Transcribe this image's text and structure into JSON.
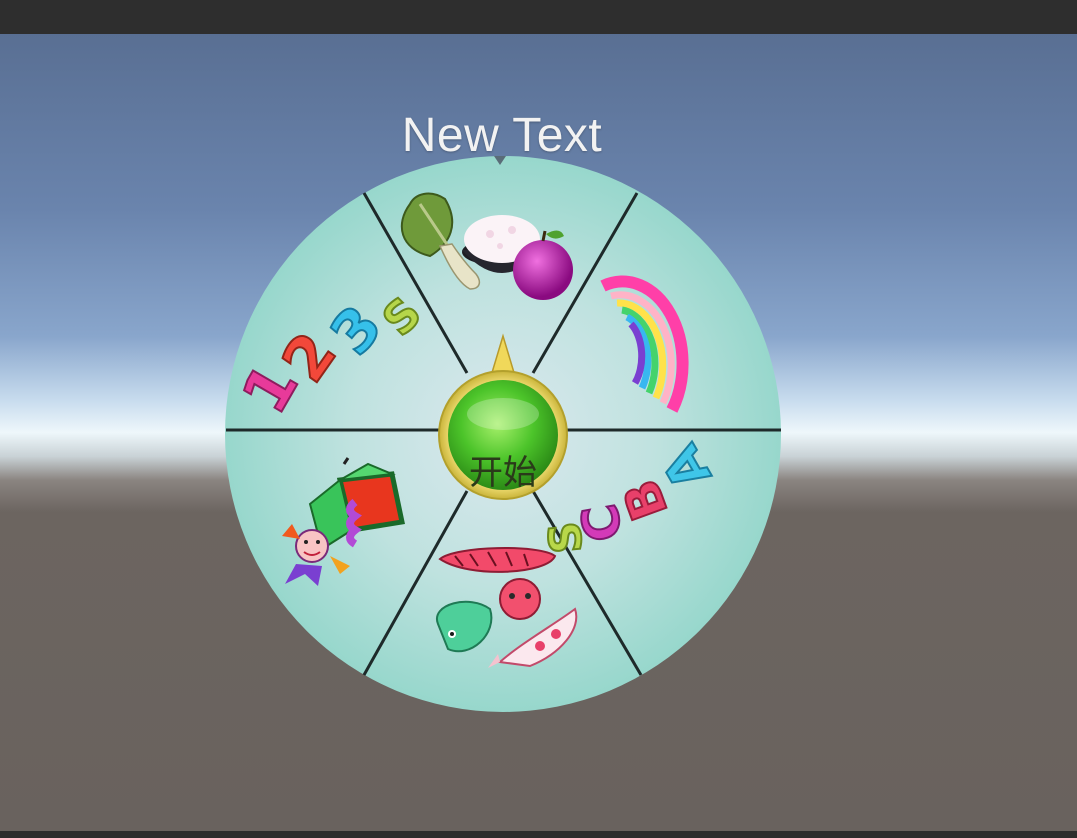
{
  "title": "New Text",
  "start_button_label": "开始",
  "segments": [
    {
      "name": "food",
      "icon": "food-icon"
    },
    {
      "name": "rainbow",
      "icon": "rainbow-icon"
    },
    {
      "name": "letters",
      "icon": "abcs-icon",
      "glyphs": [
        "A",
        "B",
        "C",
        "S"
      ]
    },
    {
      "name": "animals",
      "icon": "animals-icon"
    },
    {
      "name": "toy",
      "icon": "jack-in-box-icon"
    },
    {
      "name": "numbers",
      "icon": "numbers-icon",
      "glyphs": [
        "1",
        "2",
        "3",
        "S"
      ]
    }
  ],
  "colors": {
    "wheel_fill": "#a6dcd5",
    "wheel_center": "#d6e6ec",
    "divider": "#1e2a2a",
    "button_green": "#4cc42a",
    "button_ring": "#e2cf56",
    "pointer": "#f0d85a"
  }
}
